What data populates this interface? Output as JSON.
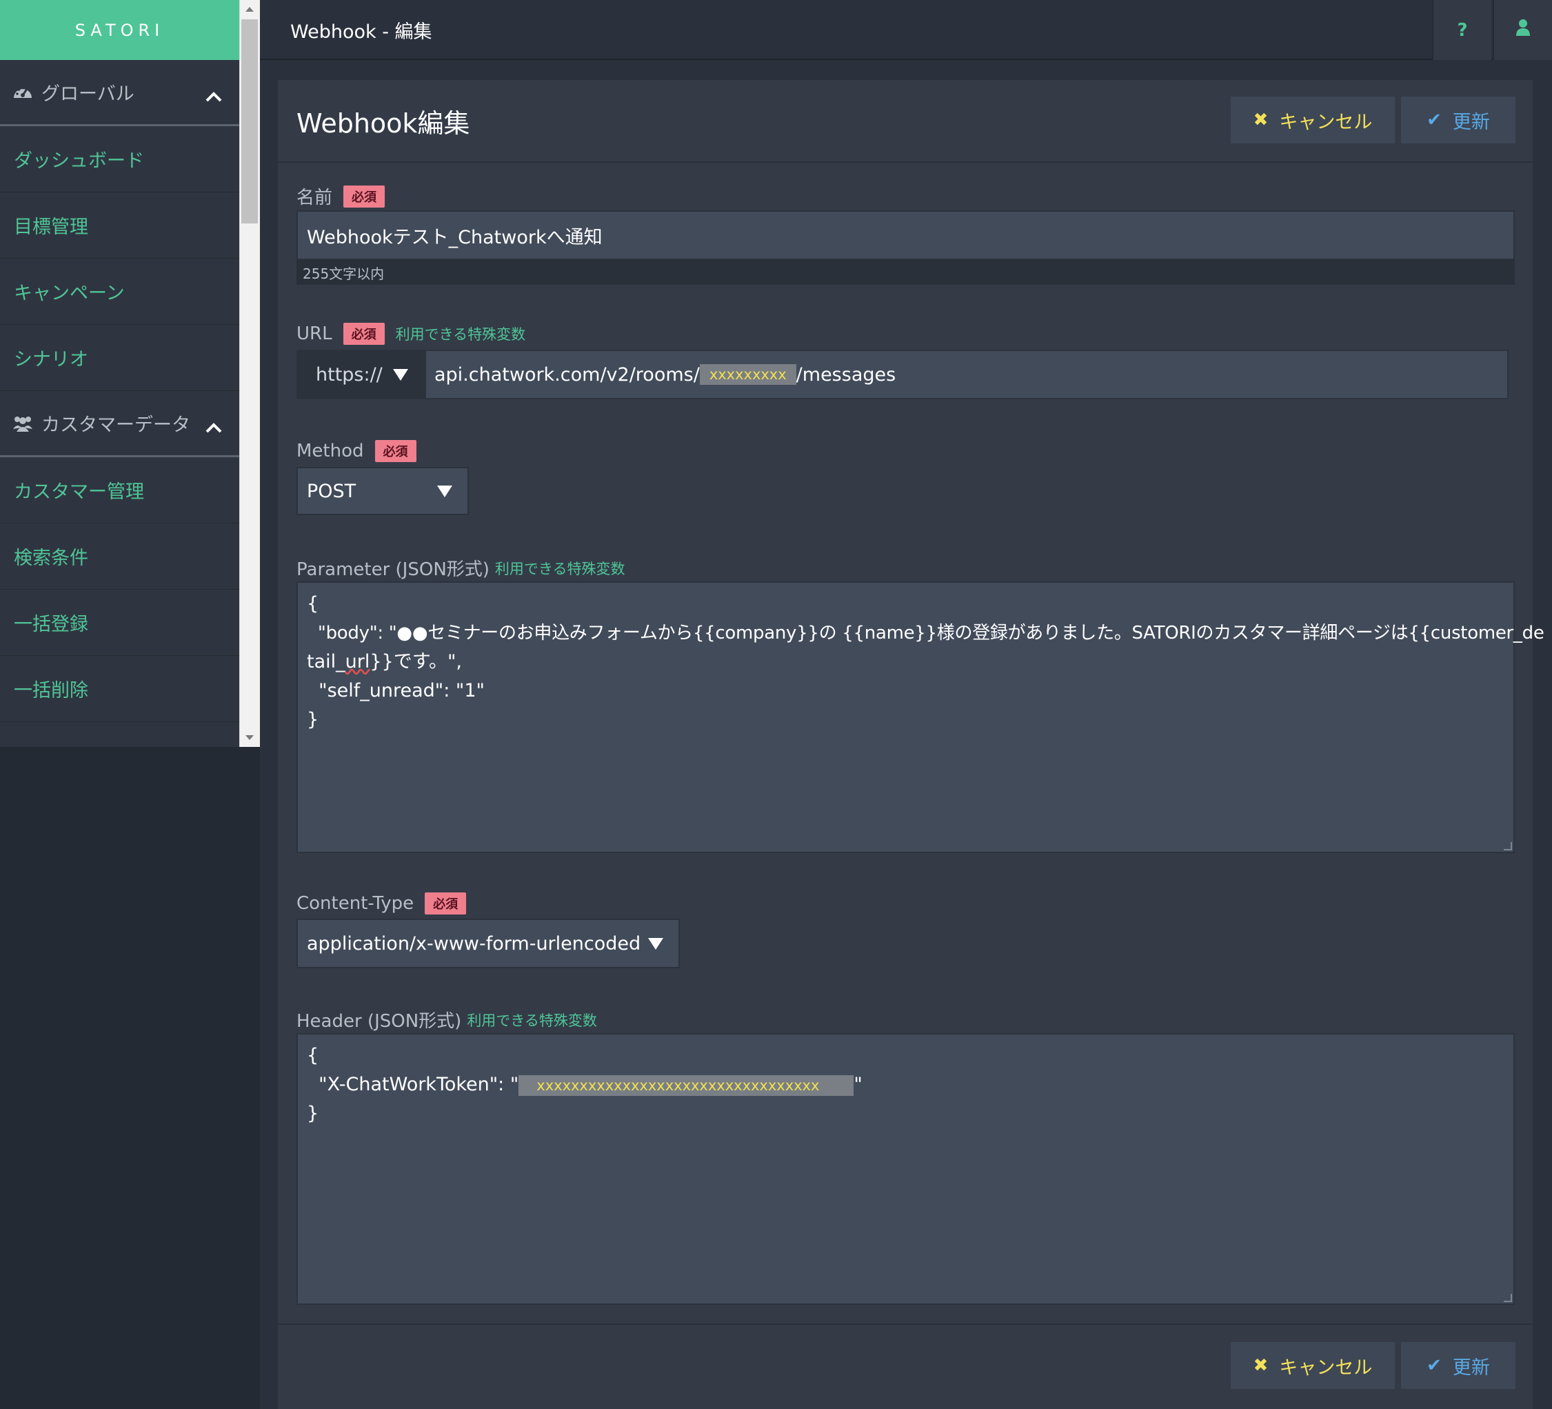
{
  "brand": "SATORI",
  "sidebar": {
    "group_global": "グローバル",
    "group_customer": "カスタマーデータ",
    "items_global": [
      "ダッシュボード",
      "目標管理",
      "キャンペーン",
      "シナリオ"
    ],
    "items_customer": [
      "カスタマー管理",
      "検索条件",
      "一括登録",
      "一括削除"
    ]
  },
  "topbar": {
    "title": "Webhook - 編集",
    "help_label": "?"
  },
  "card": {
    "title": "Webhook編集",
    "cancel_label": "キャンセル",
    "update_label": "更新"
  },
  "form": {
    "required_badge": "必須",
    "special_vars_link": "利用できる特殊変数",
    "name_label": "名前",
    "name_value": "Webhookテスト_Chatworkへ通知",
    "name_hint": "255文字以内",
    "url_label": "URL",
    "url_scheme": "https://",
    "url_prefix": "api.chatwork.com/v2/rooms/",
    "url_masked": "xxxxxxxxx",
    "url_suffix": "/messages",
    "method_label": "Method",
    "method_value": "POST",
    "param_label": "Parameter (JSON形式)",
    "param_lines": [
      "{",
      "  \"body\": \"●●セミナーのお申込みフォームから{{company}}の {{name}}様の登録がありました。SATORIのカスタマー詳細ページは{{customer_de",
      "tail_",
      "url",
      "}}です。\",",
      "  \"self_unread\": \"1\"",
      "}"
    ],
    "content_type_label": "Content-Type",
    "content_type_value": "application/x-www-form-urlencoded",
    "header_label": "Header (JSON形式)",
    "header_line1": "{",
    "header_line2_prefix": "  \"X-ChatWorkToken\": \"",
    "header_token_masked": "xxxxxxxxxxxxxxxxxxxxxxxxxxxxxxxxx",
    "header_line2_suffix": "\"",
    "header_line3": "}"
  },
  "colors": {
    "accent": "#4fc597",
    "required_badge": "#f07f8e",
    "cancel": "#f4e15a",
    "update": "#5aa9e6"
  }
}
